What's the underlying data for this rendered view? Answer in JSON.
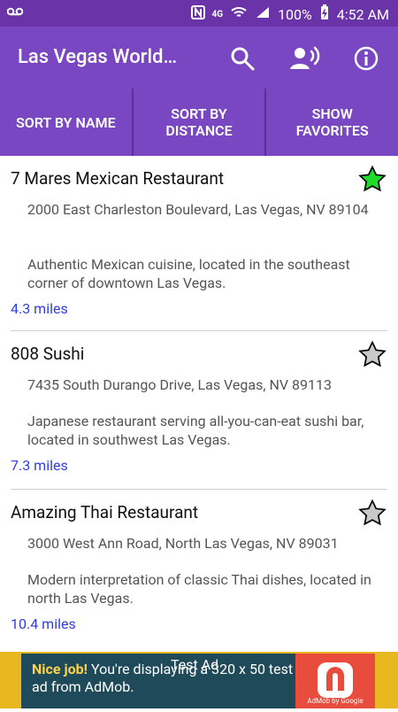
{
  "status_bar": {
    "left_icon": "voicemail-icon",
    "battery_percent": "100%",
    "time": "4:52 AM"
  },
  "app_bar": {
    "title": "Las Vegas World…",
    "actions": [
      "search-icon",
      "voice-icon",
      "info-icon"
    ]
  },
  "sort_bar": {
    "buttons": [
      "SORT BY NAME",
      "SORT BY\nDISTANCE",
      "SHOW\nFAVORITES"
    ]
  },
  "restaurants": [
    {
      "name": "7 Mares Mexican Restaurant",
      "address": "2000 East Charleston Boulevard, Las Vegas, NV 89104",
      "description": "Authentic Mexican cuisine, located in the southeast corner of downtown Las Vegas.",
      "distance": "4.3 miles",
      "favorite": true
    },
    {
      "name": "808 Sushi",
      "address": "7435 South Durango Drive, Las Vegas, NV 89113",
      "description": "Japanese restaurant serving all-you-can-eat sushi bar, located in southwest Las Vegas.",
      "distance": "7.3 miles",
      "favorite": false
    },
    {
      "name": "Amazing Thai Restaurant",
      "address": "3000 West Ann Road, North Las Vegas, NV 89031",
      "description": "Modern interpretation of classic Thai dishes, located in north Las Vegas.",
      "distance": "10.4 miles",
      "favorite": false
    }
  ],
  "ad": {
    "label": "Test Ad",
    "headline": "Nice job!",
    "body": "You're displaying a 320 x 50 test ad from AdMob.",
    "provider": "AdMob by Google"
  },
  "colors": {
    "status_bar": "#6a34a8",
    "app_bar": "#7a47c2",
    "divider": "#5b2f98",
    "favorite_star": "#1fdc2b",
    "distance_text": "#2f3de0",
    "ad_border": "#e9b821",
    "ad_bg": "#1e4a59",
    "ad_logo": "#e74c3c"
  }
}
